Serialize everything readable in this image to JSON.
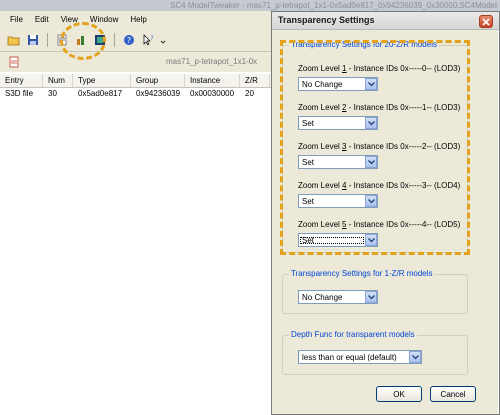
{
  "app": {
    "title": "SC4 ModelTweaker - mas71_p-tetrapot_1x1-0x5ad0e817_0x94236039_0x30000.SC4Model",
    "menu": [
      "File",
      "Edit",
      "View",
      "Window",
      "Help"
    ],
    "file_label": "mas71_p-tetrapot_1x1-0x",
    "table": {
      "columns": [
        "Entry",
        "Num",
        "Type",
        "Group",
        "Instance",
        "Z/R"
      ],
      "rows": [
        [
          "S3D file",
          "30",
          "0x5ad0e817",
          "0x94236039",
          "0x00030000",
          "20"
        ]
      ]
    }
  },
  "dialog": {
    "title": "Transparency Settings",
    "group1": {
      "legend": "Transparency Settings for 20-Z/R models",
      "levels": [
        {
          "label_pre": "Zoom Level ",
          "num": "1",
          "label_post": " - Instance IDs 0x-----0-- (LOD3)",
          "value": "No Change"
        },
        {
          "label_pre": "Zoom Level ",
          "num": "2",
          "label_post": " - Instance IDs 0x-----1-- (LOD3)",
          "value": "Set"
        },
        {
          "label_pre": "Zoom Level ",
          "num": "3",
          "label_post": " - Instance IDs 0x-----2-- (LOD3)",
          "value": "Set"
        },
        {
          "label_pre": "Zoom Level ",
          "num": "4",
          "label_post": " - Instance IDs 0x-----3-- (LOD4)",
          "value": "Set"
        },
        {
          "label_pre": "Zoom Level ",
          "num": "5",
          "label_post": " - Instance IDs 0x-----4-- (LOD5)",
          "value": "Set"
        }
      ]
    },
    "group2": {
      "legend": "Transparency Settings for 1-Z/R models",
      "value": "No Change"
    },
    "group3": {
      "legend": "Depth Func for transparent models",
      "value": "less than or equal (default)"
    },
    "ok_label": "OK",
    "cancel_label": "Cancel"
  },
  "colors": {
    "highlight": "#e3a21a",
    "legend": "#0046d5"
  }
}
